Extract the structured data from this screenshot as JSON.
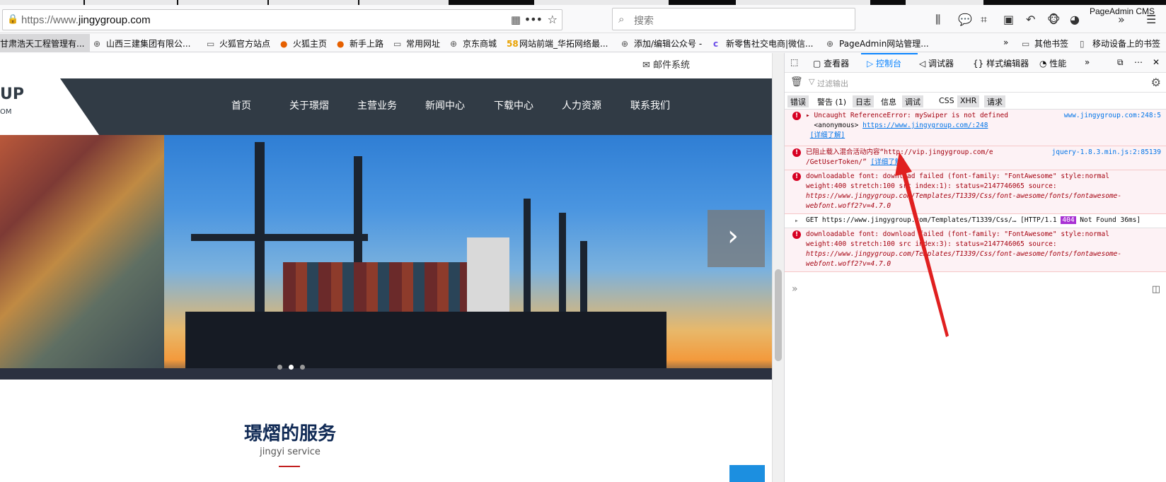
{
  "browser": {
    "url_prefix": "https://www.",
    "url_domain": "jingygroup.com",
    "search_placeholder": "搜索",
    "top_right_label": "PageAdmin CMS",
    "icons": [
      "lock-icon",
      "qr-code-icon",
      "page-actions-icon",
      "bookmark-star-icon",
      "search-icon",
      "library-icon",
      "chat-icon",
      "crop-icon",
      "sidebar-icon",
      "undo-icon",
      "monkey-icon",
      "avatar-icon",
      "overflow-icon",
      "menu-icon"
    ]
  },
  "bookmarks": {
    "first": "甘肃浩天工程管理有...",
    "items": [
      "山西三建集团有限公...",
      "火狐官方站点",
      "火狐主页",
      "新手上路",
      "常用网址",
      "京东商城",
      "网站前端_华拓网络最...",
      "添加/编辑公众号 -",
      "新零售社交电商|微信...",
      "PageAdmin网站管理..."
    ],
    "other": "其他书签",
    "mobile": "移动设备上的书签"
  },
  "site": {
    "mail": "邮件系统",
    "logo_main": "UP",
    "logo_sub": "OM",
    "nav": [
      "首页",
      "关于璟熠",
      "主营业务",
      "新闻中心",
      "下载中心",
      "人力资源",
      "联系我们"
    ],
    "service_title": "璟熠的服务",
    "service_subtitle": "jingyi service",
    "hero_next": "›"
  },
  "devtools": {
    "tabs": [
      "查看器",
      "控制台",
      "调试器",
      "样式编辑器",
      "性能"
    ],
    "selected_tab": "控制台",
    "filter_placeholder": "过滤输出",
    "categories": [
      "错误",
      "警告 (1)",
      "日志",
      "信息",
      "调试",
      "CSS",
      "XHR",
      "请求"
    ],
    "messages": [
      {
        "type": "error",
        "text": "Uncaught ReferenceError: mySwiper is not defined",
        "line2_label": "<anonymous>",
        "line2_link": "https://www.jingygroup.com/:248",
        "learn_more": "[详细了解]",
        "source": "www.jingygroup.com:248:5"
      },
      {
        "type": "error",
        "text": "已阻止载入混合活动内容“http://vip.jingygroup.com/e",
        "text2": "/GetUserToken/”",
        "learn_more": "[详细了解]",
        "source": "jquery-1.8.3.min.js:2:85139"
      },
      {
        "type": "error",
        "lines": [
          "downloadable font: download failed (font-family: \"FontAwesome\" style:normal",
          "weight:400 stretch:100 src index:1): status=2147746065 source:",
          "https://www.jingygroup.com/Templates/T1339/Css/font-awesome/fonts/fontawesome-",
          "webfont.woff2?v=4.7.0"
        ]
      },
      {
        "type": "network",
        "text": "GET https://www.jingygroup.com/Templates/T1339/Css/…",
        "status_prefix": "[HTTP/1.1",
        "status_code": "404",
        "status_suffix": "Not Found 36ms]"
      },
      {
        "type": "error",
        "lines": [
          "downloadable font: download failed (font-family: \"FontAwesome\" style:normal",
          "weight:400 stretch:100 src index:3): status=2147746065 source:",
          "https://www.jingygroup.com/Templates/T1339/Css/font-awesome/fonts/fontawesome-",
          "webfont.woff2?v=4.7.0"
        ]
      }
    ],
    "prompt": "»"
  },
  "colors": {
    "nav_bg": "#313b45",
    "accent": "#0a84ff",
    "error_text": "#a4000f",
    "error_bg": "#fdf2f5",
    "badge_404": "#a832d4",
    "arrow": "#e02020"
  }
}
